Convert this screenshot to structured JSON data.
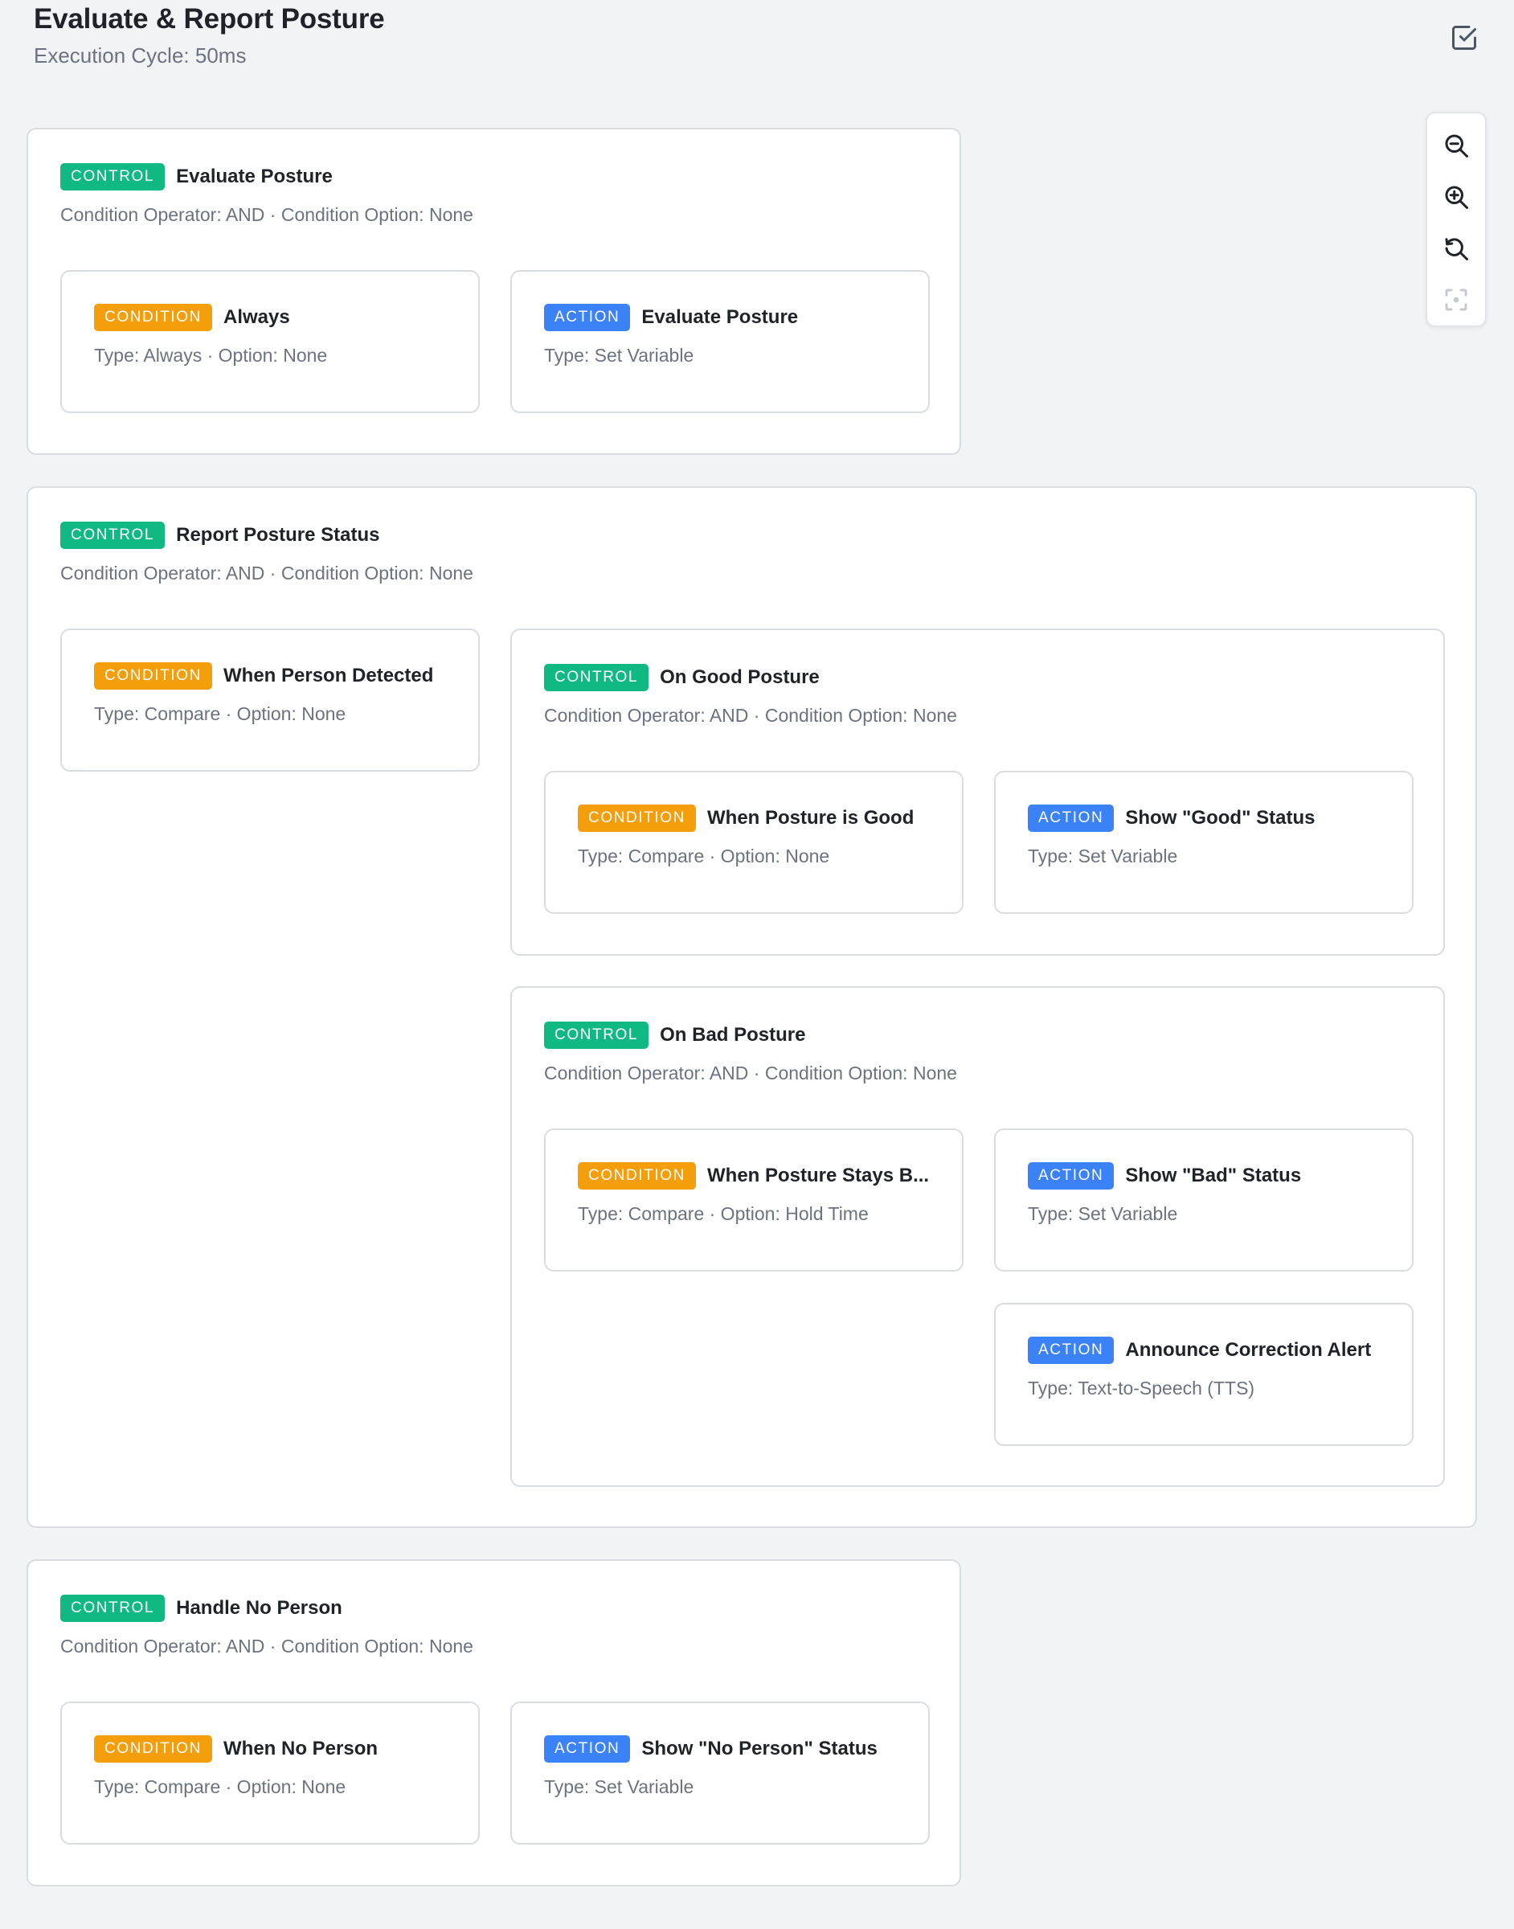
{
  "header": {
    "title": "Evaluate & Report Posture",
    "subtitle": "Execution Cycle: 50ms",
    "confirm_icon": "check-square-icon"
  },
  "badges": {
    "control": "CONTROL",
    "condition": "CONDITION",
    "action": "ACTION"
  },
  "blocks": {
    "evaluate": {
      "title": "Evaluate Posture",
      "meta": "Condition Operator: AND · Condition Option: None",
      "condition": {
        "title": "Always",
        "meta": "Type: Always · Option: None"
      },
      "action": {
        "title": "Evaluate Posture",
        "meta": "Type: Set Variable"
      }
    },
    "report": {
      "title": "Report Posture Status",
      "meta": "Condition Operator: AND · Condition Option: None",
      "condition": {
        "title": "When Person Detected",
        "meta": "Type: Compare · Option: None"
      },
      "good": {
        "title": "On Good Posture",
        "meta": "Condition Operator: AND · Condition Option: None",
        "condition": {
          "title": "When Posture is Good",
          "meta": "Type: Compare · Option: None"
        },
        "action": {
          "title": "Show \"Good\" Status",
          "meta": "Type: Set Variable"
        }
      },
      "bad": {
        "title": "On Bad Posture",
        "meta": "Condition Operator: AND · Condition Option: None",
        "condition": {
          "title": "When Posture Stays B...",
          "meta": "Type: Compare · Option: Hold Time"
        },
        "action1": {
          "title": "Show \"Bad\" Status",
          "meta": "Type: Set Variable"
        },
        "action2": {
          "title": "Announce Correction Alert",
          "meta": "Type: Text-to-Speech (TTS)"
        }
      }
    },
    "noperson": {
      "title": "Handle No Person",
      "meta": "Condition Operator: AND · Condition Option: None",
      "condition": {
        "title": "When No Person",
        "meta": "Type: Compare · Option: None"
      },
      "action": {
        "title": "Show \"No Person\" Status",
        "meta": "Type: Set Variable"
      }
    }
  },
  "zoom_controls": [
    "zoom-out-icon",
    "zoom-in-icon",
    "reset-zoom-icon",
    "fit-view-icon"
  ]
}
